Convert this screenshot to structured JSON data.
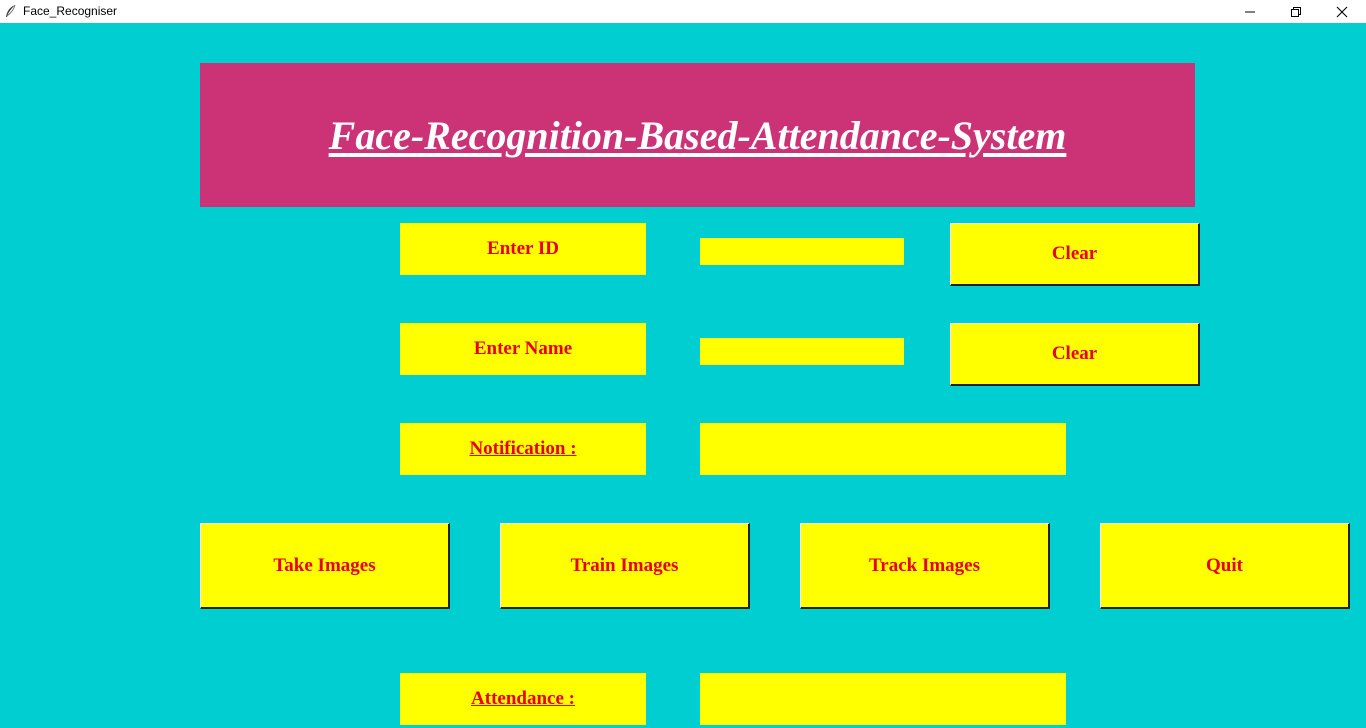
{
  "window": {
    "title": "Face_Recogniser",
    "app_icon": "feather-icon",
    "controls": {
      "minimize_icon": "minimize-icon",
      "maximize_icon": "restore-icon",
      "close_icon": "close-icon"
    }
  },
  "header": {
    "title": "Face-Recognition-Based-Attendance-System"
  },
  "form": {
    "id_label": "Enter ID",
    "id_value": "",
    "id_clear": "Clear",
    "name_label": "Enter Name",
    "name_value": "",
    "name_clear": "Clear",
    "notification_label": "Notification : ",
    "notification_text": ""
  },
  "actions": {
    "take_images": "Take Images",
    "train_images": "Train Images",
    "track_images": "Track Images",
    "quit": "Quit"
  },
  "attendance": {
    "label": "Attendance : ",
    "text": ""
  },
  "colors": {
    "background": "#00CED1",
    "banner": "#CC3377",
    "widget": "#FFFF00",
    "text": "#E8001C"
  }
}
